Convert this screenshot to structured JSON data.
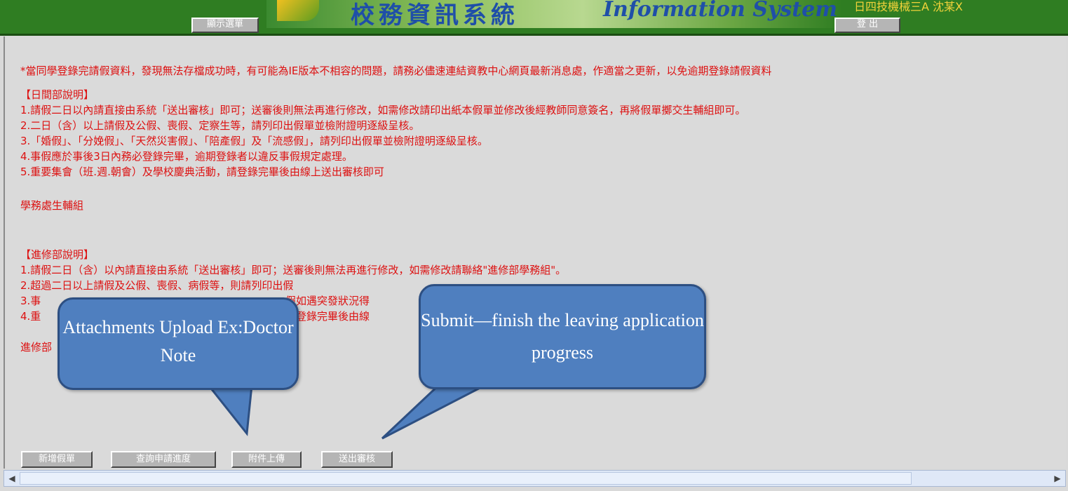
{
  "header": {
    "show_menu_label": "顯示選單",
    "logout_label": "登  出",
    "title_zh": "校務資訊系統",
    "title_en": "Information System",
    "user_info": "日四技機械三A 沈某X"
  },
  "content": {
    "notice": "*當同學登錄完請假資料，發現無法存檔成功時，有可能為IE版本不相容的問題，請務必儘速連結資教中心網頁最新消息處，作適當之更新，以免逾期登錄請假資料",
    "day_section": {
      "title": "【日間部說明】",
      "lines": [
        "1.請假二日以內請直接由系統「送出審核」即可；送審後則無法再進行修改，如需修改請印出紙本假單並修改後經教師同意簽名，再將假單擲交生輔組即可。",
        "2.二日（含）以上請假及公假、喪假、定察生等，請列印出假單並檢附證明逐級呈核。",
        "3.「婚假」、「分娩假」、「天然災害假」、「陪產假」及「流感假」，請列印出假單並檢附證明逐級呈核。",
        "4.事假應於事後3日內務必登錄完畢，逾期登錄者以違反事假規定處理。",
        "5.重要集會（班.週.朝會）及學校慶典活動，請登錄完畢後由線上送出審核即可"
      ],
      "signature": "學務處生輔組"
    },
    "night_section": {
      "title": "【進修部說明】",
      "lines": [
        "1.請假二日（含）以內請直接由系統「送出審核」即可；送審後則無法再進行修改，如需修改請聯絡\"進修部學務組\"。",
        "2.超過二日以上請假及公假、喪假、病假等，則請列印出假",
        "3.事",
        "4.重"
      ],
      "line3_tail": "假如遇突發狀況得",
      "line4_tail": "請登錄完畢後由線",
      "signature": "進修部"
    }
  },
  "buttons": {
    "new_leave": "新增假單",
    "query_progress": "查詢申請進度",
    "upload_attachment": "附件上傳",
    "submit_review": "送出審核"
  },
  "callouts": {
    "upload": "Attachments Upload Ex:Doctor Note",
    "submit": "Submit—finish the leaving application progress"
  },
  "colors": {
    "header_green": "#2f7d22",
    "text_red": "#d11",
    "callout_blue": "#4f7fbf"
  }
}
